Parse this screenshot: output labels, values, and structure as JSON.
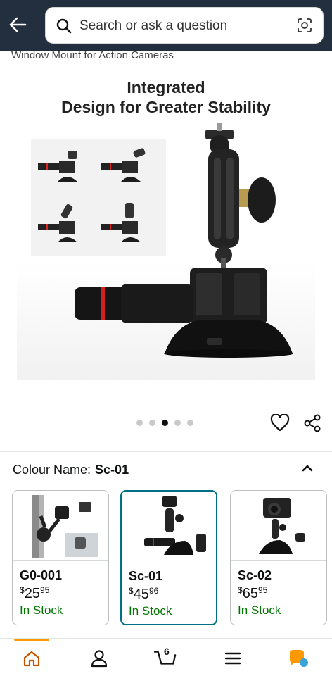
{
  "search": {
    "placeholder": "Search or ask a question"
  },
  "product": {
    "title": "Window Mount for Action Cameras",
    "hero_caption_line1": "Integrated",
    "hero_caption_line2": "Design for Greater Stability",
    "image_count": 5,
    "active_image_index": 2
  },
  "colour": {
    "label": "Colour Name:",
    "selected": "Sc-01",
    "options": [
      {
        "name": "G0-001",
        "currency": "$",
        "whole": "25",
        "cents": "95",
        "stock": "In Stock"
      },
      {
        "name": "Sc-01",
        "currency": "$",
        "whole": "45",
        "cents": "96",
        "stock": "In Stock"
      },
      {
        "name": "Sc-02",
        "currency": "$",
        "whole": "65",
        "cents": "95",
        "stock": "In Stock"
      }
    ]
  },
  "nav": {
    "cart_count": "6",
    "active": "home"
  },
  "colors": {
    "header_bg": "#232f3e",
    "accent": "#ff9900",
    "selected_border": "#007185",
    "in_stock": "#007600"
  },
  "icons": [
    "back-arrow-icon",
    "search-icon",
    "camera-lens-icon",
    "heart-icon",
    "share-icon",
    "chevron-up-icon",
    "home-icon",
    "user-icon",
    "cart-icon",
    "menu-icon",
    "assistant-icon"
  ]
}
